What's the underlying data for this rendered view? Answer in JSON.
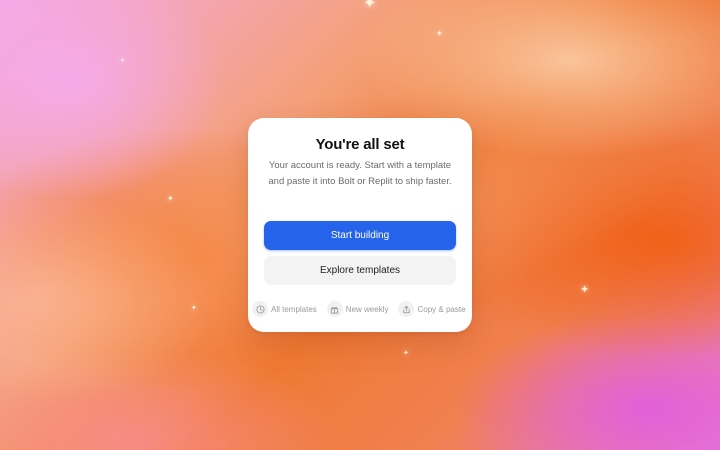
{
  "dialog": {
    "title": "You're all set",
    "subtitle": "Your account is ready. Start with a template and paste it into Bolt or Replit to ship faster.",
    "primary_button": "Start building",
    "secondary_button": "Explore templates",
    "accent_color": "#2563eb"
  },
  "features": [
    {
      "icon": "clock-icon",
      "label": "All templates"
    },
    {
      "icon": "gift-icon",
      "label": "New weekly"
    },
    {
      "icon": "share-icon",
      "label": "Copy & paste"
    }
  ],
  "background": {
    "colors": [
      "#f4a9e6",
      "#ef7a35",
      "#e77ad6"
    ],
    "decorations": "sparkle-icon"
  }
}
